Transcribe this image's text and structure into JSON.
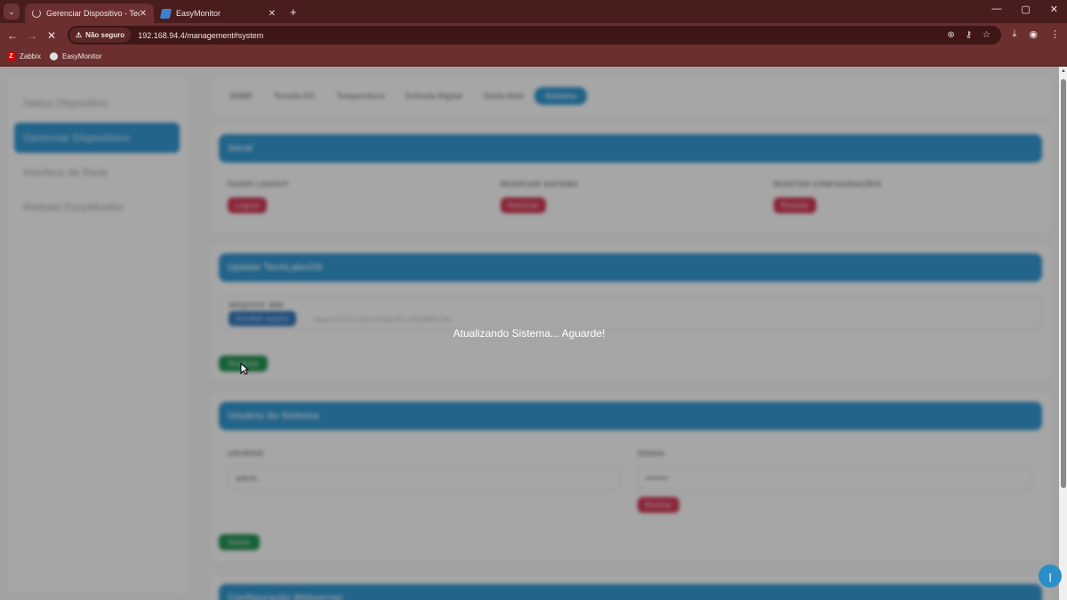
{
  "browser": {
    "tabs": [
      {
        "title": "Gerenciar Dispositivo - TechLab",
        "close": "✕"
      },
      {
        "title": "EasyMonitor",
        "close": "✕"
      }
    ],
    "new_tab": "+",
    "window_controls": [
      "—",
      "▢",
      "✕"
    ],
    "security_chip": "Não seguro",
    "url": "192.168.94.4/management#system",
    "bookmarks": [
      "Zabbix",
      "EasyMonitor"
    ]
  },
  "sidebar": {
    "items": [
      {
        "label": "Status Dispositivo"
      },
      {
        "label": "Gerenciar Dispositivos"
      },
      {
        "label": "Interface de Rede"
      },
      {
        "label": "Website EasyMonitor"
      }
    ]
  },
  "subtabs": [
    "SNMP",
    "Tensão DC",
    "Temperatura",
    "Entrada Digital",
    "Saída Relé",
    "Sistema"
  ],
  "geral": {
    "title": "Geral",
    "fazer_logout_label": "FAZER LOGOUT",
    "logout_button": "Logout",
    "reiniciar_label": "REINICIAR SISTEMA",
    "reiniciar_button": "Reiniciar",
    "resetar_label": "RESETAR CONFIGURAÇÕES",
    "resetar_button": "Resetar"
  },
  "update": {
    "title": "Update TechLabsOS",
    "arquivo_label": "ARQUIVO .BIN",
    "choose_button": "Escolher arquivo",
    "filename": "easyv1-0.5.1-snmp-build-051-20240902.bin",
    "atualizar_button": "Atualizar"
  },
  "usuario": {
    "title": "Usuário do Sistema",
    "usuario_label": "USUÁRIO",
    "usuario_value": "admin",
    "senha_label": "SENHA",
    "senha_value": "••••••••",
    "mostrar_button": "Mostrar",
    "salvar_button": "Salvar"
  },
  "webserver": {
    "title": "Configuração Webserver"
  },
  "overlay": {
    "message": "Atualizando Sistema... Aguarde!"
  }
}
